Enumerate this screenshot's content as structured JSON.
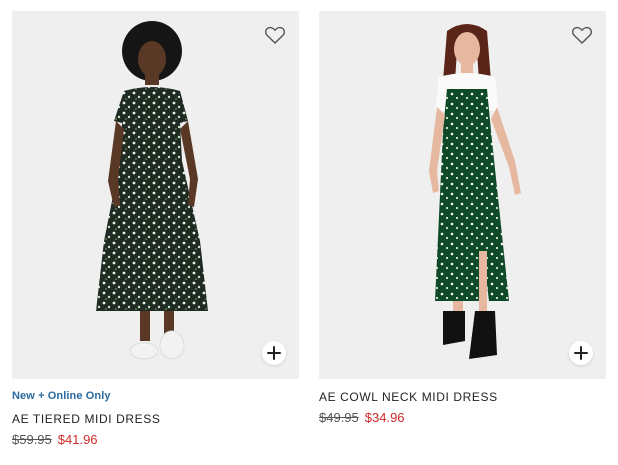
{
  "products": [
    {
      "tag": "New + Online Only",
      "name": "AE TIERED MIDI DRESS",
      "original_price": "$59.95",
      "sale_price": "$41.96",
      "icons": {
        "wishlist": "heart-outline-icon",
        "quick_add": "plus-icon"
      }
    },
    {
      "tag": "",
      "name": "AE COWL NECK MIDI DRESS",
      "original_price": "$49.95",
      "sale_price": "$34.96",
      "icons": {
        "wishlist": "heart-outline-icon",
        "quick_add": "plus-icon"
      }
    }
  ],
  "colors": {
    "tag": "#2a6a9f",
    "sale_price": "#d12b2b",
    "image_bg": "#efefef"
  }
}
